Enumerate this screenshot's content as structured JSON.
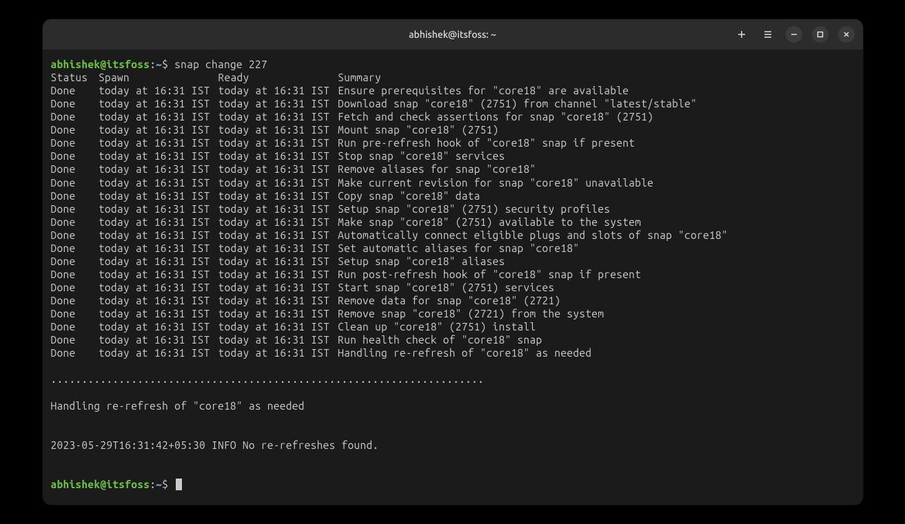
{
  "window": {
    "title": "abhishek@itsfoss: ~"
  },
  "prompt": {
    "user_host": "abhishek@itsfoss",
    "separator": ":",
    "path": "~",
    "dollar": "$"
  },
  "command": "snap change 227",
  "headers": {
    "status": "Status",
    "spawn": "Spawn",
    "ready": "Ready",
    "summary": "Summary"
  },
  "rows": [
    {
      "status": "Done",
      "spawn": "today at 16:31 IST",
      "ready": "today at 16:31 IST",
      "summary": "Ensure prerequisites for \"core18\" are available"
    },
    {
      "status": "Done",
      "spawn": "today at 16:31 IST",
      "ready": "today at 16:31 IST",
      "summary": "Download snap \"core18\" (2751) from channel \"latest/stable\""
    },
    {
      "status": "Done",
      "spawn": "today at 16:31 IST",
      "ready": "today at 16:31 IST",
      "summary": "Fetch and check assertions for snap \"core18\" (2751)"
    },
    {
      "status": "Done",
      "spawn": "today at 16:31 IST",
      "ready": "today at 16:31 IST",
      "summary": "Mount snap \"core18\" (2751)"
    },
    {
      "status": "Done",
      "spawn": "today at 16:31 IST",
      "ready": "today at 16:31 IST",
      "summary": "Run pre-refresh hook of \"core18\" snap if present"
    },
    {
      "status": "Done",
      "spawn": "today at 16:31 IST",
      "ready": "today at 16:31 IST",
      "summary": "Stop snap \"core18\" services"
    },
    {
      "status": "Done",
      "spawn": "today at 16:31 IST",
      "ready": "today at 16:31 IST",
      "summary": "Remove aliases for snap \"core18\""
    },
    {
      "status": "Done",
      "spawn": "today at 16:31 IST",
      "ready": "today at 16:31 IST",
      "summary": "Make current revision for snap \"core18\" unavailable"
    },
    {
      "status": "Done",
      "spawn": "today at 16:31 IST",
      "ready": "today at 16:31 IST",
      "summary": "Copy snap \"core18\" data"
    },
    {
      "status": "Done",
      "spawn": "today at 16:31 IST",
      "ready": "today at 16:31 IST",
      "summary": "Setup snap \"core18\" (2751) security profiles"
    },
    {
      "status": "Done",
      "spawn": "today at 16:31 IST",
      "ready": "today at 16:31 IST",
      "summary": "Make snap \"core18\" (2751) available to the system"
    },
    {
      "status": "Done",
      "spawn": "today at 16:31 IST",
      "ready": "today at 16:31 IST",
      "summary": "Automatically connect eligible plugs and slots of snap \"core18\""
    },
    {
      "status": "Done",
      "spawn": "today at 16:31 IST",
      "ready": "today at 16:31 IST",
      "summary": "Set automatic aliases for snap \"core18\""
    },
    {
      "status": "Done",
      "spawn": "today at 16:31 IST",
      "ready": "today at 16:31 IST",
      "summary": "Setup snap \"core18\" aliases"
    },
    {
      "status": "Done",
      "spawn": "today at 16:31 IST",
      "ready": "today at 16:31 IST",
      "summary": "Run post-refresh hook of \"core18\" snap if present"
    },
    {
      "status": "Done",
      "spawn": "today at 16:31 IST",
      "ready": "today at 16:31 IST",
      "summary": "Start snap \"core18\" (2751) services"
    },
    {
      "status": "Done",
      "spawn": "today at 16:31 IST",
      "ready": "today at 16:31 IST",
      "summary": "Remove data for snap \"core18\" (2721)"
    },
    {
      "status": "Done",
      "spawn": "today at 16:31 IST",
      "ready": "today at 16:31 IST",
      "summary": "Remove snap \"core18\" (2721) from the system"
    },
    {
      "status": "Done",
      "spawn": "today at 16:31 IST",
      "ready": "today at 16:31 IST",
      "summary": "Clean up \"core18\" (2751) install"
    },
    {
      "status": "Done",
      "spawn": "today at 16:31 IST",
      "ready": "today at 16:31 IST",
      "summary": "Run health check of \"core18\" snap"
    },
    {
      "status": "Done",
      "spawn": "today at 16:31 IST",
      "ready": "today at 16:31 IST",
      "summary": "Handling re-refresh of \"core18\" as needed"
    }
  ],
  "footer": {
    "dots": "......................................................................",
    "handling": "Handling re-refresh of \"core18\" as needed",
    "log_line": "2023-05-29T16:31:42+05:30 INFO No re-refreshes found."
  }
}
